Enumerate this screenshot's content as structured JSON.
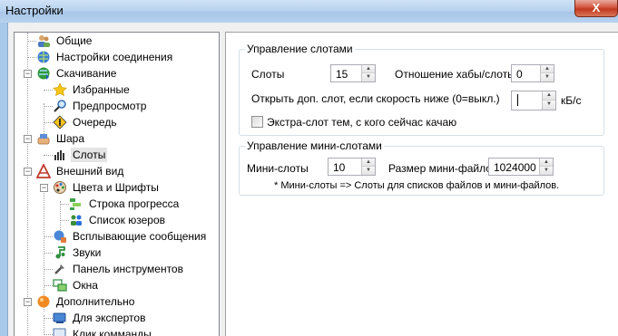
{
  "window": {
    "title": "Настройки",
    "close_glyph": "X"
  },
  "tree": {
    "items": [
      {
        "label": "Общие",
        "icon": "users-icon"
      },
      {
        "label": "Настройки соединения",
        "icon": "network-globe-icon"
      },
      {
        "label": "Скачивание",
        "icon": "download-globe-icon"
      },
      {
        "label": "Избранные",
        "icon": "star-icon"
      },
      {
        "label": "Предпросмотр",
        "icon": "magnifier-icon"
      },
      {
        "label": "Очередь",
        "icon": "queue-sign-icon"
      },
      {
        "label": "Шара",
        "icon": "share-hand-icon"
      },
      {
        "label": "Слоты",
        "icon": "slots-bars-icon"
      },
      {
        "label": "Внешний вид",
        "icon": "appearance-icon"
      },
      {
        "label": "Цвета и Шрифты",
        "icon": "palette-icon"
      },
      {
        "label": "Строка прогресса",
        "icon": "progress-icon"
      },
      {
        "label": "Список юзеров",
        "icon": "user-list-icon"
      },
      {
        "label": "Всплывающие сообщения",
        "icon": "popup-icon"
      },
      {
        "label": "Звуки",
        "icon": "music-note-icon"
      },
      {
        "label": "Панель инструментов",
        "icon": "toolbar-icon"
      },
      {
        "label": "Окна",
        "icon": "windows-icon"
      },
      {
        "label": "Дополнительно",
        "icon": "advanced-icon"
      },
      {
        "label": "Для экспертов",
        "icon": "expert-icon"
      },
      {
        "label": "Клик комманды",
        "icon": "click-command-icon"
      }
    ]
  },
  "slots_group": {
    "legend": "Управление слотами",
    "slots_label": "Слоты",
    "slots_value": "15",
    "ratio_label": "Отношение хабы/слоты",
    "ratio_value": "0",
    "speed_label": "Открыть доп. слот, если скорость ниже (0=выкл.)",
    "speed_value": "",
    "speed_unit": "кБ/с",
    "extra_slot_label": "Экстра-слот тем, с кого сейчас качаю",
    "extra_slot_checked": false
  },
  "minislots_group": {
    "legend": "Управление мини-слотами",
    "minislots_label": "Мини-слоты",
    "minislots_value": "10",
    "filesize_label": "Размер мини-файлов",
    "filesize_value": "1024000",
    "note": "* Мини-слоты => Слоты для списков файлов и мини-файлов."
  }
}
